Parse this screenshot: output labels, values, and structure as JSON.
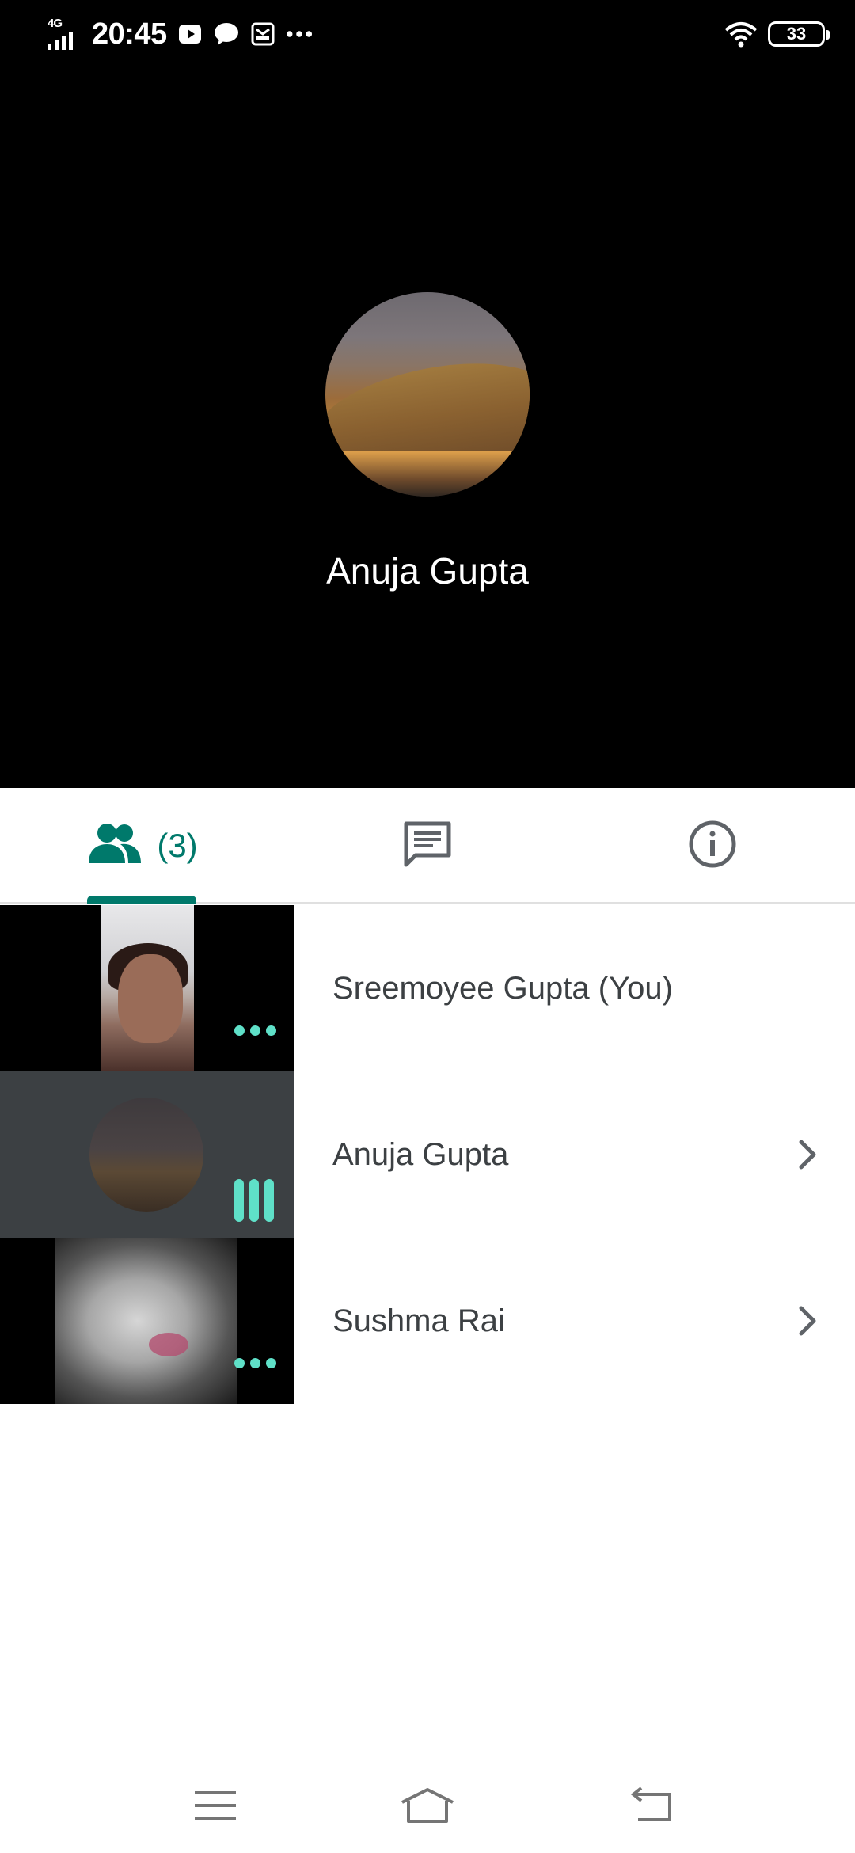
{
  "status_bar": {
    "network": "4G",
    "time": "20:45",
    "battery": "33"
  },
  "main_speaker": {
    "name": "Anuja Gupta"
  },
  "tabs": {
    "people_count": "(3)"
  },
  "participants": [
    {
      "name": "Sreemoyee Gupta (You)",
      "state": "dots"
    },
    {
      "name": "Anuja Gupta",
      "state": "speaking"
    },
    {
      "name": "Sushma Rai",
      "state": "dots"
    }
  ],
  "colors": {
    "accent": "#00796b",
    "indicator": "#5fe0c8"
  }
}
